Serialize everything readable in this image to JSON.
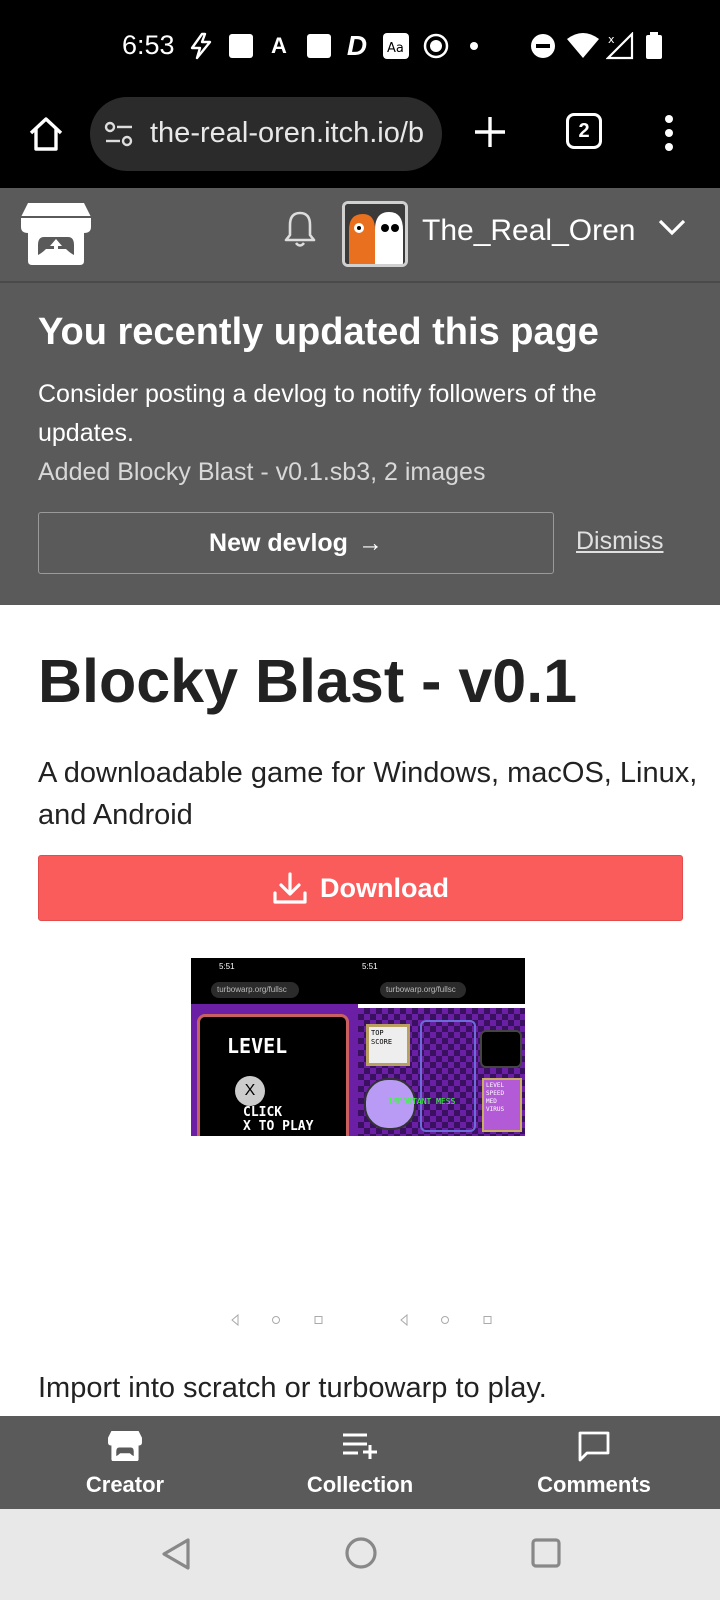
{
  "status_bar": {
    "time": "6:53",
    "icons": [
      "bolt-icon",
      "square-icon",
      "a-icon",
      "square-icon",
      "d-icon",
      "translate-icon",
      "record-icon",
      "dot-icon",
      "dnd-icon",
      "wifi-icon",
      "no-signal-icon",
      "battery-icon"
    ]
  },
  "browser": {
    "url": "the-real-oren.itch.io/b",
    "tab_count": "2"
  },
  "itch_header": {
    "username": "The_Real_Oren"
  },
  "notice": {
    "title": "You recently updated this page",
    "body": "Consider posting a devlog to notify followers of the updates.",
    "sub": "Added Blocky Blast - v0.1.sb3, 2 images",
    "devlog_button": "New devlog",
    "devlog_arrow": "→",
    "dismiss": "Dismiss"
  },
  "game": {
    "title": "Blocky Blast - v0.1",
    "subtitle": "A downloadable game for Windows, macOS, Linux, and Android",
    "download_label": "Download",
    "description": "Import into scratch or turbowarp to play."
  },
  "screenshots": [
    {
      "status_time": "5:51",
      "url": "turbowarp.org/fullsc",
      "level_text": "LEVEL",
      "x_text": "X",
      "click_text": "CLICK",
      "play_text": "X TO PLAY"
    },
    {
      "status_time": "5:51",
      "url": "turbowarp.org/fullsc",
      "top_score_1": "TOP",
      "top_score_2": "SCORE",
      "message": "IMPORTANT MESS",
      "level": "LEVEL",
      "speed": "SPEED",
      "med": "MED",
      "virus": "VIRUS"
    }
  ],
  "bottom_nav": {
    "creator": "Creator",
    "collection": "Collection",
    "comments": "Comments"
  },
  "colors": {
    "itch_gray": "#5a5a5a",
    "download_red": "#fa5c5c",
    "title_text": "#222222"
  }
}
